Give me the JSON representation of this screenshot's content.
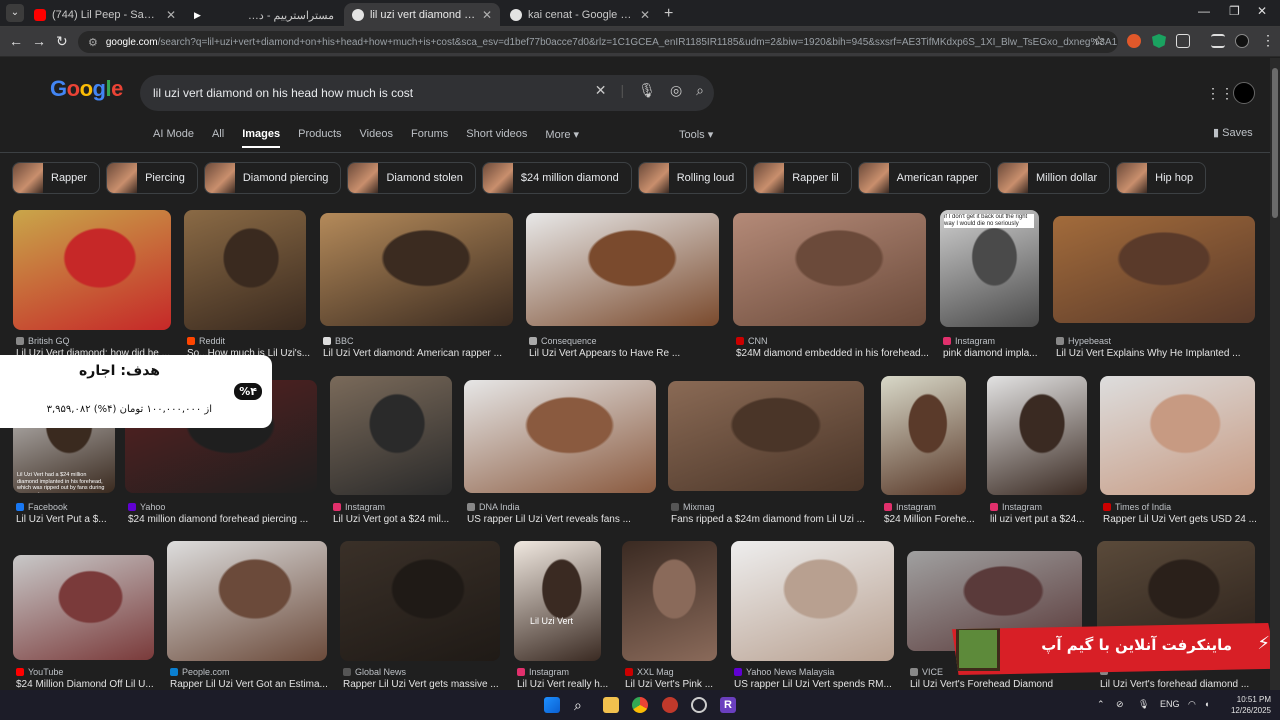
{
  "browser": {
    "tabs": [
      {
        "title": "(744) Lil Peep - Save That Shit (",
        "favicon_color": "#ff0000"
      },
      {
        "title": "",
        "favicon_color": "#ffffff"
      },
      {
        "title": "مستراسترییم - داشبورد",
        "favicon_color": "#888888"
      },
      {
        "title": "lil uzi vert diamond on his head",
        "favicon_color": "#e3e3e3"
      },
      {
        "title": "kai cenat - Google Search",
        "favicon_color": "#e3e3e3"
      }
    ],
    "url_host": "google.com",
    "url_path": "/search?q=lil+uzi+vert+diamond+on+his+head+how+much+is+cost&sca_esv=d1bef77b0acce7d0&rlz=1C1GCEA_enIR1185IR1185&udm=2&biw=1920&bih=945&sxsrf=AE3TifMKdxp6S_1XI_Blw_TsEGxo_dxneg%3A17667767..."
  },
  "google": {
    "logo": "Google",
    "query": "lil uzi vert diamond on his head how much is cost",
    "tabs": [
      "AI Mode",
      "All",
      "Images",
      "Products",
      "Videos",
      "Forums",
      "Short videos",
      "More ▾"
    ],
    "tools": "Tools ▾",
    "saves": "Saves",
    "chips": [
      "Rapper",
      "Piercing",
      "Diamond piercing",
      "Diamond stolen",
      "$24 million diamond",
      "Rolling loud",
      "Rapper lil",
      "American rapper",
      "Million dollar",
      "Hip hop"
    ],
    "results": [
      {
        "source": "British GQ",
        "title": "Lil Uzi Vert diamond: how did he ...",
        "sc": "#888"
      },
      {
        "source": "Reddit",
        "title": "So...How much is Lil Uzi's...",
        "sc": "#ff4500"
      },
      {
        "source": "BBC",
        "title": "Lil Uzi Vert diamond: American rapper ...",
        "sc": "#ddd"
      },
      {
        "source": "Consequence",
        "title": "Lil Uzi Vert Appears to Have Re ...",
        "sc": "#aaa"
      },
      {
        "source": "CNN",
        "title": "$24M diamond embedded in his forehead...",
        "sc": "#cc0000"
      },
      {
        "source": "Instagram",
        "title": "pink diamond impla...",
        "sc": "#e1306c"
      },
      {
        "source": "Hypebeast",
        "title": "Lil Uzi Vert Explains Why He Implanted ...",
        "sc": "#888"
      },
      {
        "source": "Facebook",
        "title": "Lil Uzi Vert Put a $...",
        "sc": "#1877f2"
      },
      {
        "source": "Yahoo",
        "title": "$24 million diamond forehead piercing ...",
        "sc": "#6001d2"
      },
      {
        "source": "Instagram",
        "title": "Lil Uzi Vert got a $24 mil...",
        "sc": "#e1306c"
      },
      {
        "source": "DNA India",
        "title": "US rapper Lil Uzi Vert reveals fans ...",
        "sc": "#888"
      },
      {
        "source": "Mixmag",
        "title": "Fans ripped a $24m diamond from Lil Uzi ...",
        "sc": "#555"
      },
      {
        "source": "Instagram",
        "title": "$24 Million Forehe...",
        "sc": "#e1306c"
      },
      {
        "source": "Instagram",
        "title": "lil uzi vert put a $24...",
        "sc": "#e1306c"
      },
      {
        "source": "Times of India",
        "title": "Rapper Lil Uzi Vert gets USD 24 ...",
        "sc": "#cc0000"
      },
      {
        "source": "YouTube",
        "title": "$24 Million Diamond Off Lil U...",
        "sc": "#ff0000"
      },
      {
        "source": "People.com",
        "title": "Rapper Lil Uzi Vert Got an Estima...",
        "sc": "#0a7fd1"
      },
      {
        "source": "Global News",
        "title": "Rapper Lil Uzi Vert gets massive ...",
        "sc": "#555"
      },
      {
        "source": "Instagram",
        "title": "Lil Uzi Vert really h...",
        "sc": "#e1306c"
      },
      {
        "source": "XXL Mag",
        "title": "Lil Uzi Vert's Pink ...",
        "sc": "#cc0000"
      },
      {
        "source": "Yahoo News Malaysia",
        "title": "US rapper Lil Uzi Vert spends RM...",
        "sc": "#6001d2"
      },
      {
        "source": "VICE",
        "title": "Lil Uzi Vert's Forehead Diamond",
        "sc": "#888"
      },
      {
        "source": "",
        "title": "Lil Uzi Vert's forehead diamond ...",
        "sc": "#888"
      }
    ],
    "image_texts": {
      "instagram_caption": "if I don't get it back out the right way I would die no seriously",
      "facebook_caption": "Lil Uzi Vert had a $24 million diamond implanted in his forehead, which was ripped out by fans during a concert.",
      "instagram_watermark": "Lil Uzi Vert"
    }
  },
  "overlays": {
    "goal_heading": "هدف: اجاره",
    "goal_percent": "%۴",
    "goal_progress": "۳,۹۵۹,۰۸۲ از ۱۰۰,۰۰۰,۰۰۰ تومان (۴%)",
    "goal_progress_fraction": 0.04,
    "minecraft_banner": "ماینکرفت آنلاین با گیم آپ"
  },
  "taskbar": {
    "lang": "ENG",
    "time": "10:51 PM",
    "date": "12/26/2025"
  }
}
